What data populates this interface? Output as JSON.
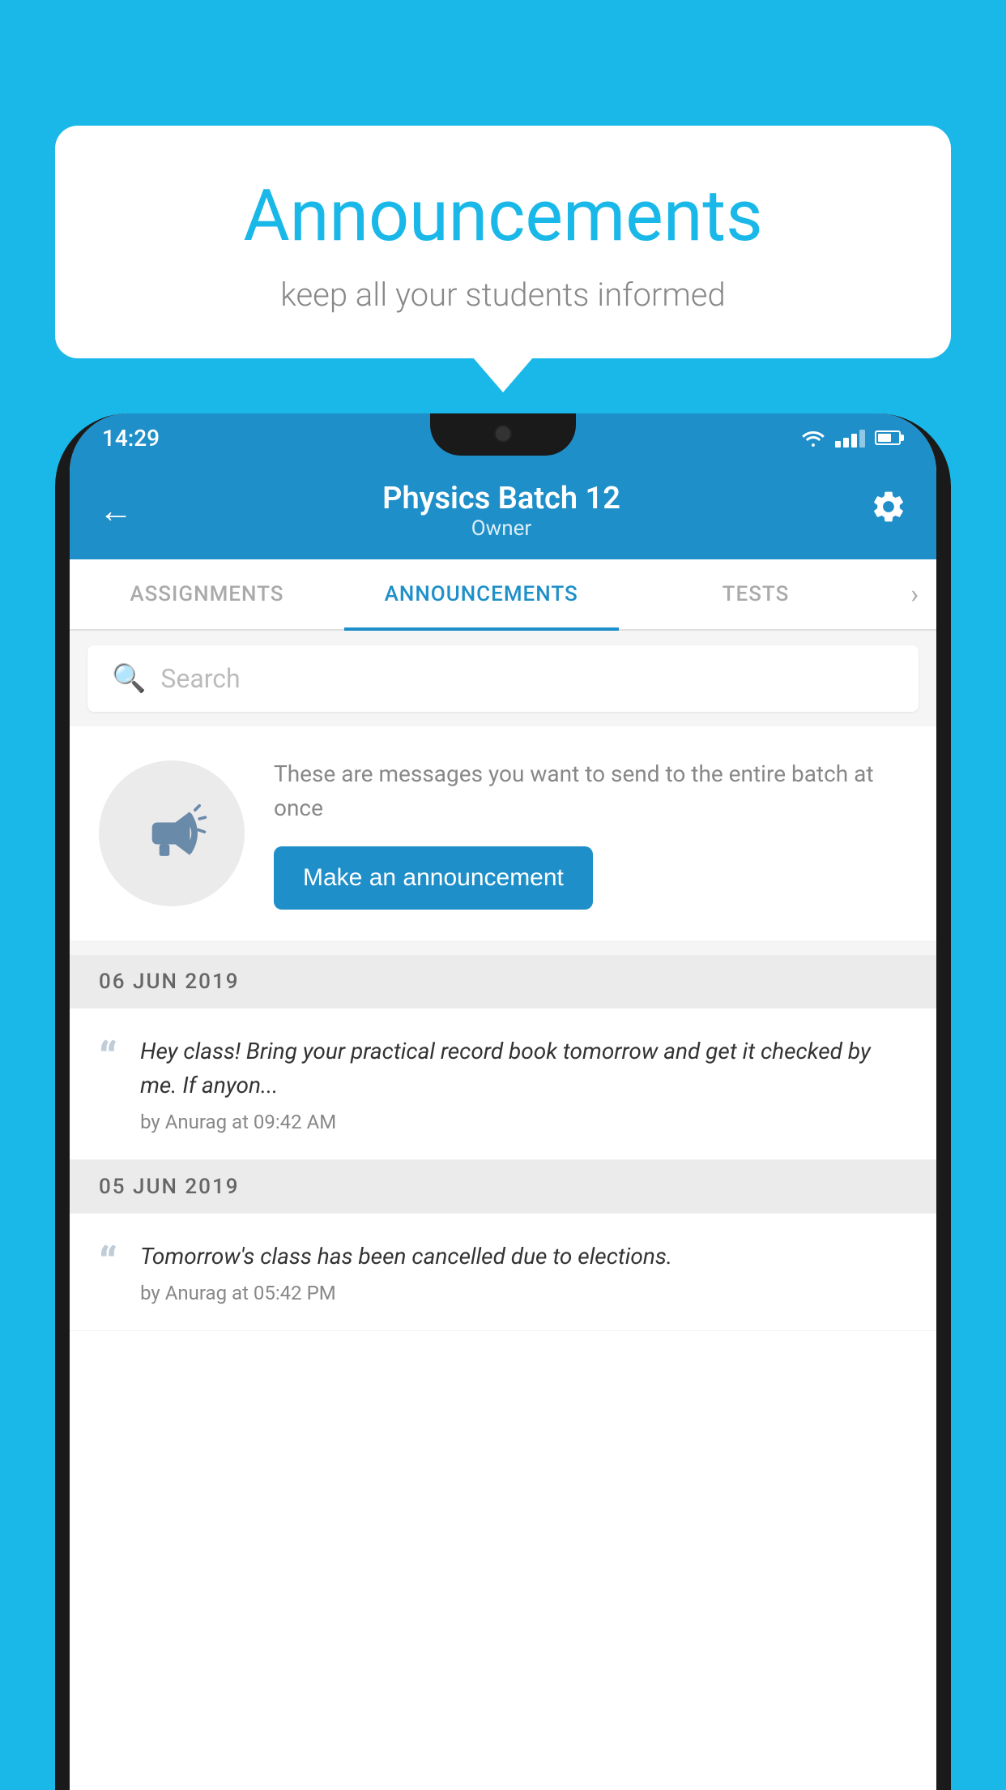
{
  "background_color": "#1ab8e8",
  "speech_bubble": {
    "title": "Announcements",
    "subtitle": "keep all your students informed"
  },
  "status_bar": {
    "time": "14:29",
    "wifi": true,
    "signal": true,
    "battery": true
  },
  "app_header": {
    "title": "Physics Batch 12",
    "subtitle": "Owner",
    "back_label": "Back",
    "settings_label": "Settings"
  },
  "tabs": [
    {
      "label": "ASSIGNMENTS",
      "active": false
    },
    {
      "label": "ANNOUNCEMENTS",
      "active": true
    },
    {
      "label": "TESTS",
      "active": false
    }
  ],
  "search": {
    "placeholder": "Search"
  },
  "empty_state": {
    "description": "These are messages you want to send to the entire batch at once",
    "button_label": "Make an announcement"
  },
  "announcement_list": [
    {
      "date": "06  JUN  2019",
      "items": [
        {
          "text": "Hey class! Bring your practical record book tomorrow and get it checked by me. If anyon...",
          "meta": "by Anurag at 09:42 AM"
        }
      ]
    },
    {
      "date": "05  JUN  2019",
      "items": [
        {
          "text": "Tomorrow's class has been cancelled due to elections.",
          "meta": "by Anurag at 05:42 PM"
        }
      ]
    }
  ]
}
